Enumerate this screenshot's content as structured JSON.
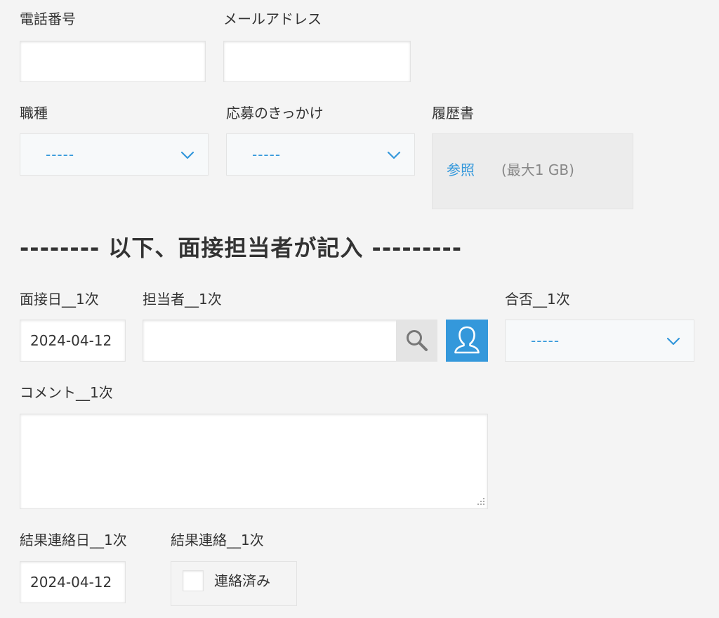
{
  "fields": {
    "phone": {
      "label": "電話番号",
      "value": ""
    },
    "email": {
      "label": "メールアドレス",
      "value": ""
    },
    "job_type": {
      "label": "職種",
      "selected": "-----"
    },
    "trigger": {
      "label": "応募のきっかけ",
      "selected": "-----"
    },
    "resume": {
      "label": "履歴書",
      "browse_label": "参照",
      "max_size": "(最大1 GB)"
    }
  },
  "section": {
    "heading": "--------  以下、面接担当者が記入  ---------"
  },
  "interview": {
    "date": {
      "label": "面接日__1次",
      "value": "2024-04-12"
    },
    "interviewer": {
      "label": "担当者__1次",
      "value": ""
    },
    "result": {
      "label": "合否__1次",
      "selected": "-----"
    },
    "comment": {
      "label": "コメント__1次",
      "value": ""
    },
    "contact_date": {
      "label": "結果連絡日__1次",
      "value": "2024-04-12"
    },
    "contact": {
      "label": "結果連絡__1次",
      "option_label": "連絡済み",
      "checked": false
    }
  },
  "icons": {
    "select_chevron": "chevron-down-icon",
    "search": "search-icon",
    "user": "user-icon",
    "resize": "resize-grip-icon"
  },
  "colors": {
    "accent": "#3498db",
    "background": "#f4f4f4",
    "text": "#333333",
    "muted": "#888888"
  }
}
